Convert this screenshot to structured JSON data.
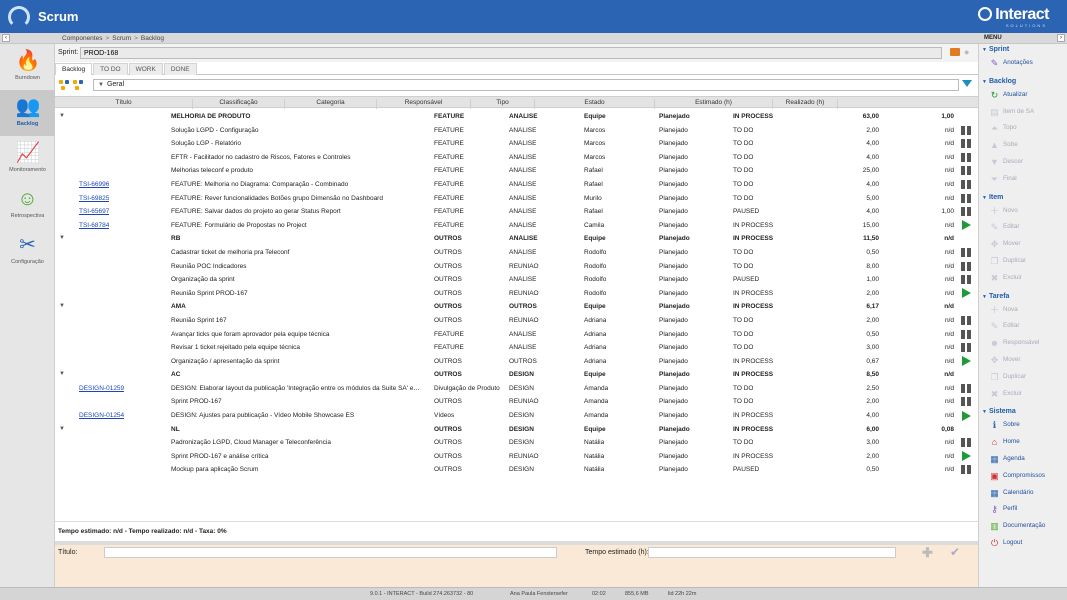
{
  "app": {
    "title": "Scrum",
    "brand": "Interact",
    "brand_sub": "SOLUTIONS"
  },
  "breadcrumb": [
    "Componentes",
    "Scrum",
    "Backlog"
  ],
  "menu_header": "MENU",
  "left_nav": [
    {
      "label": "Burndown",
      "icon": "flame-icon"
    },
    {
      "label": "Backlog",
      "icon": "people-icon",
      "active": true
    },
    {
      "label": "Monitoramento",
      "icon": "chart-icon"
    },
    {
      "label": "Retrospectiva",
      "icon": "smiley-icon"
    },
    {
      "label": "Configuração",
      "icon": "tools-icon"
    }
  ],
  "sprint": {
    "label": "Sprint:",
    "value": "PROD-168"
  },
  "tabs": [
    "Backlog",
    "TO DO",
    "WORK",
    "DONE"
  ],
  "filter": {
    "value": "Geral"
  },
  "columns": [
    "Título",
    "Classificação",
    "Categoria",
    "Responsável",
    "Tipo",
    "Estado",
    "Estimado (h)",
    "Realizado (h)"
  ],
  "rows": [
    {
      "group": true,
      "title": "MELHORIA DE PRODUTO",
      "cla": "FEATURE",
      "cat": "ANÁLISE",
      "res": "Equipe",
      "tip": "Planejado",
      "est": "IN PROCESS",
      "est2": "63,00",
      "rea": "1,00"
    },
    {
      "title": "Solução LGPD - Configuração",
      "cla": "FEATURE",
      "cat": "ANÁLISE",
      "res": "Marcos",
      "tip": "Planejado",
      "est": "TO DO",
      "est2": "2,00",
      "rea": "n/d",
      "btn": "pause"
    },
    {
      "title": "Solução LGP - Relatório",
      "cla": "FEATURE",
      "cat": "ANÁLISE",
      "res": "Marcos",
      "tip": "Planejado",
      "est": "TO DO",
      "est2": "4,00",
      "rea": "n/d",
      "btn": "pause"
    },
    {
      "title": "EFTR - Facilitador no cadastro de Riscos, Fatores e Controles",
      "cla": "FEATURE",
      "cat": "ANÁLISE",
      "res": "Marcos",
      "tip": "Planejado",
      "est": "TO DO",
      "est2": "4,00",
      "rea": "n/d",
      "btn": "pause"
    },
    {
      "title": "Melhorias teleconf e produto",
      "cla": "FEATURE",
      "cat": "ANÁLISE",
      "res": "Rafael",
      "tip": "Planejado",
      "est": "TO DO",
      "est2": "25,00",
      "rea": "n/d",
      "btn": "pause"
    },
    {
      "id": "TSI-66996",
      "title": "FEATURE: Melhoria no Diagrama: Comparação - Combinado",
      "cla": "FEATURE",
      "cat": "ANÁLISE",
      "res": "Rafael",
      "tip": "Planejado",
      "est": "TO DO",
      "est2": "4,00",
      "rea": "n/d",
      "btn": "pause"
    },
    {
      "id": "TSI-69825",
      "title": "FEATURE: Rever funcionalidades Botões grupo Dimensão no Dashboard",
      "cla": "FEATURE",
      "cat": "ANÁLISE",
      "res": "Murilo",
      "tip": "Planejado",
      "est": "TO DO",
      "est2": "5,00",
      "rea": "n/d",
      "btn": "pause"
    },
    {
      "id": "TSI-65697",
      "title": "FEATURE: Salvar dados do projeto ao gerar Status Report",
      "cla": "FEATURE",
      "cat": "ANÁLISE",
      "res": "Rafael",
      "tip": "Planejado",
      "est": "PAUSED",
      "est2": "4,00",
      "rea": "1,00",
      "btn": "pause"
    },
    {
      "id": "TSI-68784",
      "title": "FEATURE: Formulário de Propostas no Project",
      "cla": "FEATURE",
      "cat": "ANÁLISE",
      "res": "Camila",
      "tip": "Planejado",
      "est": "IN PROCESS",
      "est2": "15,00",
      "rea": "n/d",
      "btn": "play"
    },
    {
      "group": true,
      "title": "RB",
      "cla": "OUTROS",
      "cat": "ANÁLISE",
      "res": "Equipe",
      "tip": "Planejado",
      "est": "IN PROCESS",
      "est2": "11,50",
      "rea": "n/d"
    },
    {
      "title": "Cadastrar ticket de melhoria pra Teleconf",
      "cla": "OUTROS",
      "cat": "ANÁLISE",
      "res": "Rodolfo",
      "tip": "Planejado",
      "est": "TO DO",
      "est2": "0,50",
      "rea": "n/d",
      "btn": "pause"
    },
    {
      "title": "Reunião POC Indicadores",
      "cla": "OUTROS",
      "cat": "REUNIÃO",
      "res": "Rodolfo",
      "tip": "Planejado",
      "est": "TO DO",
      "est2": "8,00",
      "rea": "n/d",
      "btn": "pause"
    },
    {
      "title": "Organização da sprint",
      "cla": "OUTROS",
      "cat": "ANÁLISE",
      "res": "Rodolfo",
      "tip": "Planejado",
      "est": "PAUSED",
      "est2": "1,00",
      "rea": "n/d",
      "btn": "pause"
    },
    {
      "title": "Reunião Sprint PROD-167",
      "cla": "OUTROS",
      "cat": "REUNIÃO",
      "res": "Rodolfo",
      "tip": "Planejado",
      "est": "IN PROCESS",
      "est2": "2,00",
      "rea": "n/d",
      "btn": "play"
    },
    {
      "group": true,
      "title": "AMA",
      "cla": "OUTROS",
      "cat": "OUTROS",
      "res": "Equipe",
      "tip": "Planejado",
      "est": "IN PROCESS",
      "est2": "6,17",
      "rea": "n/d"
    },
    {
      "title": "Reunião Sprint 167",
      "cla": "OUTROS",
      "cat": "REUNIÃO",
      "res": "Adriana",
      "tip": "Planejado",
      "est": "TO DO",
      "est2": "2,00",
      "rea": "n/d",
      "btn": "pause"
    },
    {
      "title": "Avançar ticks que foram aprovador pela equipe técnica",
      "cla": "FEATURE",
      "cat": "ANÁLISE",
      "res": "Adriana",
      "tip": "Planejado",
      "est": "TO DO",
      "est2": "0,50",
      "rea": "n/d",
      "btn": "pause"
    },
    {
      "title": "Revisar 1 ticket rejeitado pela equipe técnica",
      "cla": "FEATURE",
      "cat": "ANÁLISE",
      "res": "Adriana",
      "tip": "Planejado",
      "est": "TO DO",
      "est2": "3,00",
      "rea": "n/d",
      "btn": "pause"
    },
    {
      "title": "Organização / apresentação da sprint",
      "cla": "OUTROS",
      "cat": "OUTROS",
      "res": "Adriana",
      "tip": "Planejado",
      "est": "IN PROCESS",
      "est2": "0,67",
      "rea": "n/d",
      "btn": "play"
    },
    {
      "group": true,
      "title": "AC",
      "cla": "OUTROS",
      "cat": "DESIGN",
      "res": "Equipe",
      "tip": "Planejado",
      "est": "IN PROCESS",
      "est2": "8,50",
      "rea": "n/d"
    },
    {
      "id": "DESIGN-01259",
      "title": "DESIGN: Elaborar layout da publicação 'Integração entre os módulos da Suite SA' e…",
      "cla": "Divulgação de Produto",
      "cat": "DESIGN",
      "res": "Amanda",
      "tip": "Planejado",
      "est": "TO DO",
      "est2": "2,50",
      "rea": "n/d",
      "btn": "pause"
    },
    {
      "title": "Sprint PROD-167",
      "cla": "OUTROS",
      "cat": "REUNIÃO",
      "res": "Amanda",
      "tip": "Planejado",
      "est": "TO DO",
      "est2": "2,00",
      "rea": "n/d",
      "btn": "pause"
    },
    {
      "id": "DESIGN-01254",
      "title": "DESIGN: Ajustes para publicação - Vídeo Mobile Showcase ES",
      "cla": "Vídeos",
      "cat": "DESIGN",
      "res": "Amanda",
      "tip": "Planejado",
      "est": "IN PROCESS",
      "est2": "4,00",
      "rea": "n/d",
      "btn": "play"
    },
    {
      "group": true,
      "title": "NL",
      "cla": "OUTROS",
      "cat": "DESIGN",
      "res": "Equipe",
      "tip": "Planejado",
      "est": "IN PROCESS",
      "est2": "6,00",
      "rea": "0,08"
    },
    {
      "title": "Padronização LGPD, Cloud Manager e Teleconferência",
      "cla": "OUTROS",
      "cat": "DESIGN",
      "res": "Natália",
      "tip": "Planejado",
      "est": "TO DO",
      "est2": "3,00",
      "rea": "n/d",
      "btn": "pause"
    },
    {
      "title": "Sprint PROD-167 e análise crítica",
      "cla": "OUTROS",
      "cat": "REUNIÃO",
      "res": "Natália",
      "tip": "Planejado",
      "est": "IN PROCESS",
      "est2": "2,00",
      "rea": "n/d",
      "btn": "play"
    },
    {
      "title": "Mockup para aplicação Scrum",
      "cla": "OUTROS",
      "cat": "DESIGN",
      "res": "Natália",
      "tip": "Planejado",
      "est": "PAUSED",
      "est2": "0,50",
      "rea": "n/d",
      "btn": "pause"
    }
  ],
  "summary": "Tempo estimado: n/d - Tempo realizado: n/d - Taxa: 0%",
  "edit": {
    "title_label": "Título:",
    "est_label": "Tempo estimado (h):"
  },
  "right_menu": [
    {
      "section": "Sprint",
      "items": [
        {
          "label": "Anotações",
          "icon": "pencil-icon",
          "enabled": true
        }
      ]
    },
    {
      "section": "Backlog",
      "items": [
        {
          "label": "Atualizar",
          "icon": "refresh-icon",
          "enabled": true
        },
        {
          "label": "Item de SA",
          "icon": "item-icon",
          "enabled": false
        },
        {
          "label": "Topo",
          "icon": "top-icon",
          "enabled": false
        },
        {
          "label": "Sobe",
          "icon": "up-icon",
          "enabled": false
        },
        {
          "label": "Descer",
          "icon": "down-icon",
          "enabled": false
        },
        {
          "label": "Final",
          "icon": "bottom-icon",
          "enabled": false
        }
      ]
    },
    {
      "section": "Item",
      "items": [
        {
          "label": "Novo",
          "icon": "plus-icon",
          "enabled": false
        },
        {
          "label": "Editar",
          "icon": "pencil-icon",
          "enabled": false
        },
        {
          "label": "Mover",
          "icon": "move-icon",
          "enabled": false
        },
        {
          "label": "Duplicar",
          "icon": "copy-icon",
          "enabled": false
        },
        {
          "label": "Excluir",
          "icon": "delete-icon",
          "enabled": false
        }
      ]
    },
    {
      "section": "Tarefa",
      "items": [
        {
          "label": "Nova",
          "icon": "plus-icon",
          "enabled": false
        },
        {
          "label": "Editar",
          "icon": "pencil-icon",
          "enabled": false
        },
        {
          "label": "Responsável",
          "icon": "person-icon",
          "enabled": false
        },
        {
          "label": "Mover",
          "icon": "move-icon",
          "enabled": false
        },
        {
          "label": "Duplicar",
          "icon": "copy-icon",
          "enabled": false
        },
        {
          "label": "Excluir",
          "icon": "delete-icon",
          "enabled": false
        }
      ]
    },
    {
      "section": "Sistema",
      "items": [
        {
          "label": "Sobre",
          "icon": "info-icon",
          "enabled": true
        },
        {
          "label": "Home",
          "icon": "home-icon",
          "enabled": true
        },
        {
          "label": "Agenda",
          "icon": "agenda-icon",
          "enabled": true
        },
        {
          "label": "Compromissos",
          "icon": "briefcase-icon",
          "enabled": true
        },
        {
          "label": "Calendário",
          "icon": "calendar-icon",
          "enabled": true
        },
        {
          "label": "Perfil",
          "icon": "key-icon",
          "enabled": true
        },
        {
          "label": "Documentação",
          "icon": "docs-icon",
          "enabled": true
        },
        {
          "label": "Logout",
          "icon": "logout-icon",
          "enabled": true
        }
      ]
    }
  ],
  "status": [
    "9.0.1 - INTERACT - Build 274.263732 - 80",
    "Ana Paula Fenstersefer",
    "02:02",
    "855,6 MB",
    "lid 22h 22m"
  ],
  "colors": {
    "header_blue": "#2a64b2",
    "link_blue": "#1a47b8",
    "play_green": "#1f9a3a",
    "edit_panel": "#f9e9d6"
  }
}
